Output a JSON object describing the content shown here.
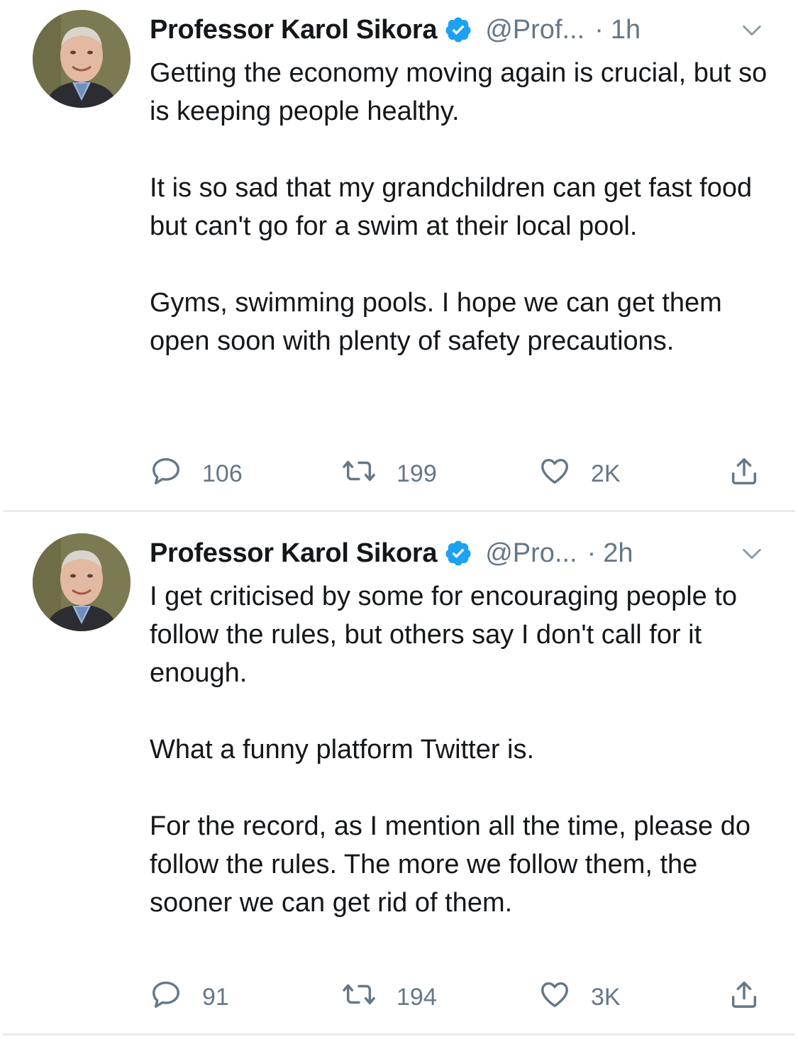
{
  "tweets": [
    {
      "author_name": "Professor Karol Sikora",
      "handle": "@Prof...",
      "separator": "·",
      "time": "1h",
      "paragraphs": [
        "Getting the economy moving again is crucial, but so is keeping people healthy.",
        "It is so sad that my grandchildren can get fast food but can't go for a swim at their local pool.",
        "Gyms, swimming pools. I hope we can get them open soon with plenty of safety precautions."
      ],
      "replies": "106",
      "retweets": "199",
      "likes": "2K"
    },
    {
      "author_name": "Professor Karol Sikora",
      "handle": "@Pro...",
      "separator": "·",
      "time": "2h",
      "paragraphs": [
        "I get criticised by some for encouraging people to follow the rules, but others say I don't call for it enough.",
        "What a funny platform Twitter is.",
        "For the record, as I mention all the time, please do follow the rules. The more we follow them, the sooner we can get rid of them."
      ],
      "replies": "91",
      "retweets": "194",
      "likes": "3K"
    }
  ],
  "icons": {
    "verified": "verified-badge-icon",
    "caret": "chevron-down-icon",
    "reply": "reply-icon",
    "retweet": "retweet-icon",
    "like": "heart-icon",
    "share": "share-icon"
  },
  "colors": {
    "verified_blue": "#1da1f2",
    "muted_text": "#657786",
    "divider": "#e6ecf0"
  }
}
